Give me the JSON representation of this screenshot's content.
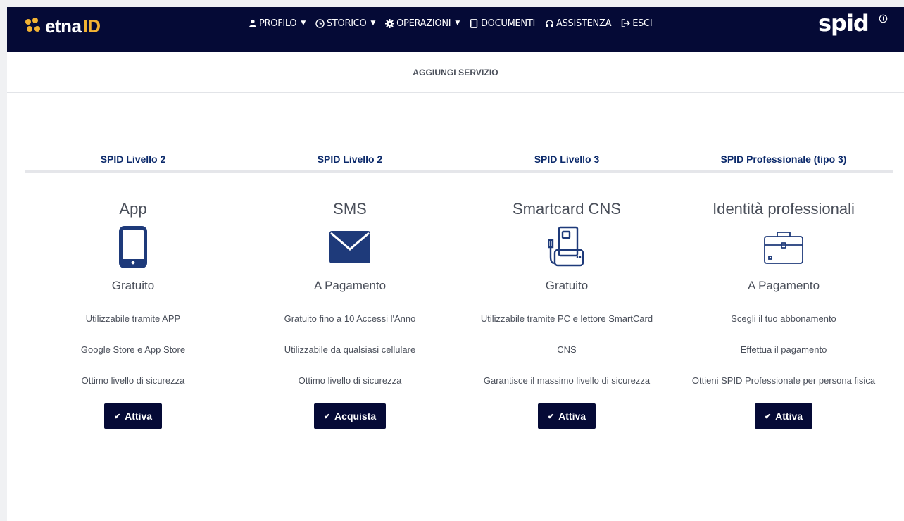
{
  "brand": {
    "logo_part1": "etna",
    "logo_part2": "ID",
    "spid_logo": "spid"
  },
  "colors": {
    "navbar": "#050a36",
    "accent": "#f2b233",
    "heading": "#0c2a6b",
    "button": "#050a36"
  },
  "nav": [
    {
      "label": "PROFILO",
      "icon": "user-icon",
      "dropdown": true
    },
    {
      "label": "STORICO",
      "icon": "clock-icon",
      "dropdown": true
    },
    {
      "label": "OPERAZIONI",
      "icon": "gear-icon",
      "dropdown": true
    },
    {
      "label": "DOCUMENTI",
      "icon": "document-icon",
      "dropdown": false
    },
    {
      "label": "ASSISTENZA",
      "icon": "headset-icon",
      "dropdown": false
    },
    {
      "label": "ESCI",
      "icon": "logout-icon",
      "dropdown": false
    }
  ],
  "page_title": "AGGIUNGI SERVIZIO",
  "plans": [
    {
      "level": "SPID Livello 2",
      "name": "App",
      "icon": "smartphone-icon",
      "price": "Gratuito",
      "features": [
        "Utilizzabile tramite APP",
        "Google Store e App Store",
        "Ottimo livello di sicurezza"
      ],
      "button": "Attiva"
    },
    {
      "level": "SPID Livello 2",
      "name": "SMS",
      "icon": "envelope-icon",
      "price": "A Pagamento",
      "features": [
        "Gratuito fino a 10 Accessi l'Anno",
        "Utilizzabile da qualsiasi cellulare",
        "Ottimo livello di sicurezza"
      ],
      "button": "Acquista"
    },
    {
      "level": "SPID Livello 3",
      "name": "Smartcard CNS",
      "icon": "smartcard-reader-icon",
      "price": "Gratuito",
      "features": [
        "Utilizzabile tramite PC e lettore SmartCard",
        "CNS",
        "Garantisce il massimo livello di sicurezza"
      ],
      "button": "Attiva"
    },
    {
      "level": "SPID Professionale (tipo 3)",
      "name": "Identità professionali",
      "icon": "briefcase-icon",
      "price": "A Pagamento",
      "features": [
        "Scegli il tuo abbonamento",
        "Effettua il pagamento",
        "Ottieni SPID Professionale per persona fisica"
      ],
      "button": "Attiva"
    }
  ]
}
